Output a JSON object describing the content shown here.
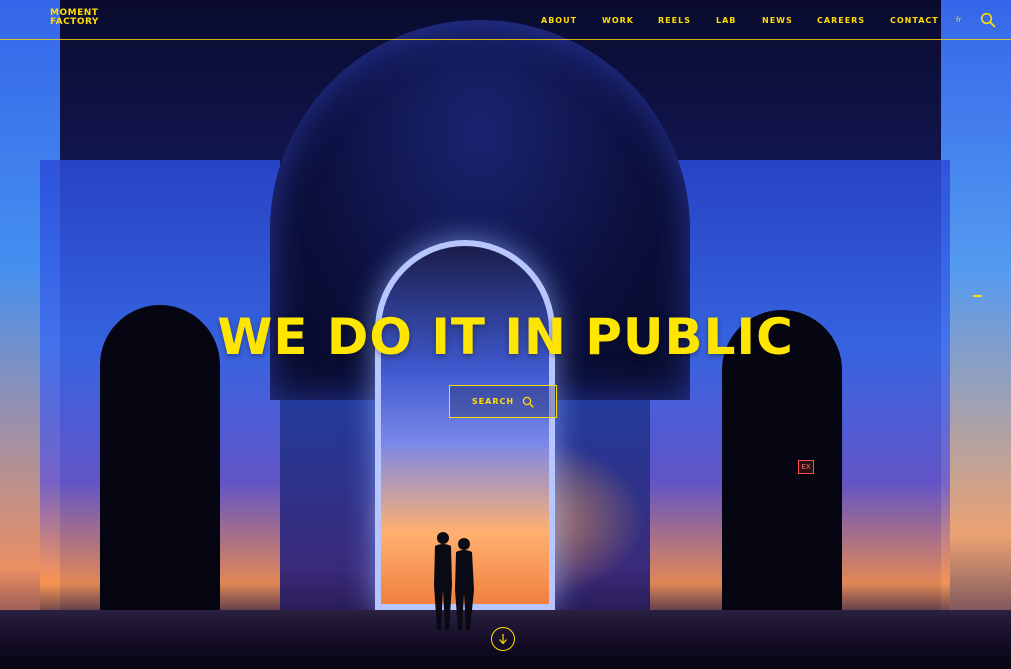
{
  "brand": {
    "logo_line1": "MOMENT",
    "logo_line2": "FACTORY",
    "accent_color": "#ffdd00"
  },
  "nav": {
    "items": [
      {
        "label": "ABOUT"
      },
      {
        "label": "WORK"
      },
      {
        "label": "REELS"
      },
      {
        "label": "LAB"
      },
      {
        "label": "NEWS"
      },
      {
        "label": "CAREERS"
      },
      {
        "label": "CONTACT"
      }
    ],
    "language": "fr",
    "search_icon": "search-icon"
  },
  "hero": {
    "headline": "WE DO IT IN PUBLIC",
    "search_label": "SEARCH",
    "search_icon": "search-icon",
    "scroll_icon": "arrow-down-icon"
  }
}
